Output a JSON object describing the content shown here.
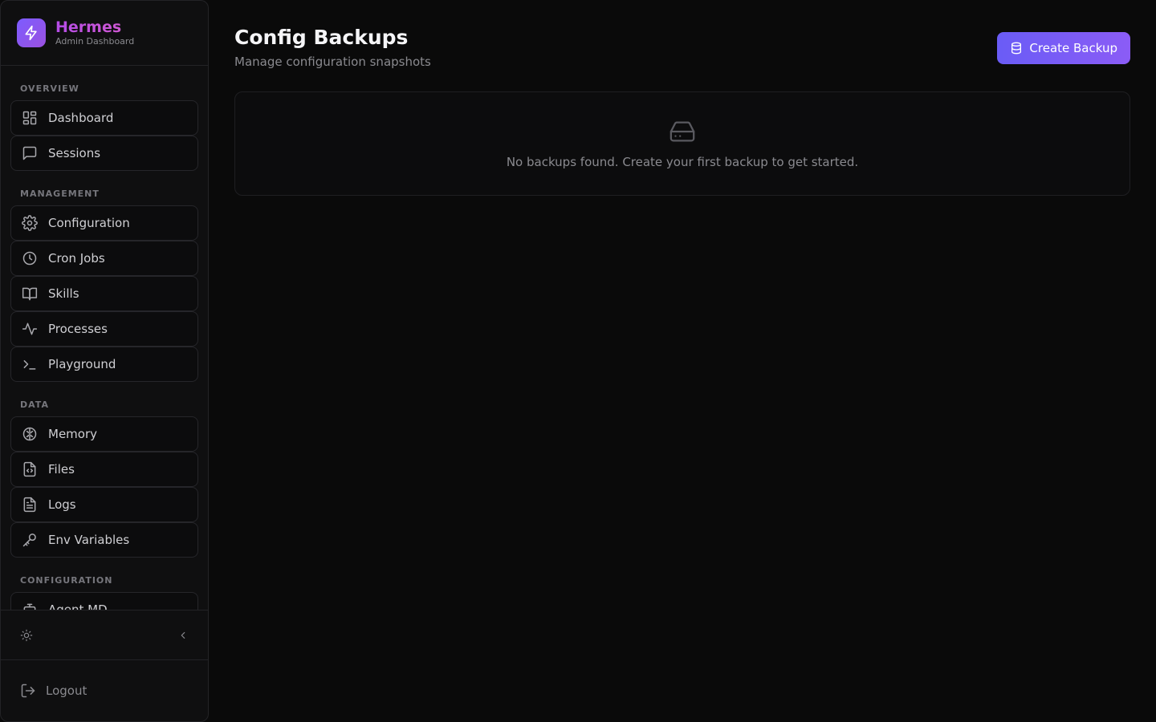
{
  "brand": {
    "title": "Hermes",
    "subtitle": "Admin Dashboard"
  },
  "sidebar": {
    "sections": [
      {
        "title": "OVERVIEW",
        "items": [
          {
            "label": "Dashboard",
            "icon": "grid-icon"
          },
          {
            "label": "Sessions",
            "icon": "message-square-icon"
          }
        ]
      },
      {
        "title": "MANAGEMENT",
        "items": [
          {
            "label": "Configuration",
            "icon": "gear-icon"
          },
          {
            "label": "Cron Jobs",
            "icon": "clock-icon"
          },
          {
            "label": "Skills",
            "icon": "book-icon"
          },
          {
            "label": "Processes",
            "icon": "activity-icon"
          },
          {
            "label": "Playground",
            "icon": "terminal-icon"
          }
        ]
      },
      {
        "title": "DATA",
        "items": [
          {
            "label": "Memory",
            "icon": "brain-icon"
          },
          {
            "label": "Files",
            "icon": "file-code-icon"
          },
          {
            "label": "Logs",
            "icon": "file-text-icon"
          },
          {
            "label": "Env Variables",
            "icon": "key-icon"
          }
        ]
      },
      {
        "title": "CONFIGURATION",
        "items": [
          {
            "label": "Agent MD",
            "icon": "bot-icon"
          }
        ]
      }
    ],
    "logout_label": "Logout"
  },
  "page": {
    "title": "Config Backups",
    "subtitle": "Manage configuration snapshots",
    "create_button_label": "Create Backup",
    "empty_message": "No backups found. Create your first backup to get started."
  },
  "colors": {
    "accent": "#7c5cff",
    "background": "#0a0a0a",
    "sidebar_bg": "#0f0f10"
  }
}
